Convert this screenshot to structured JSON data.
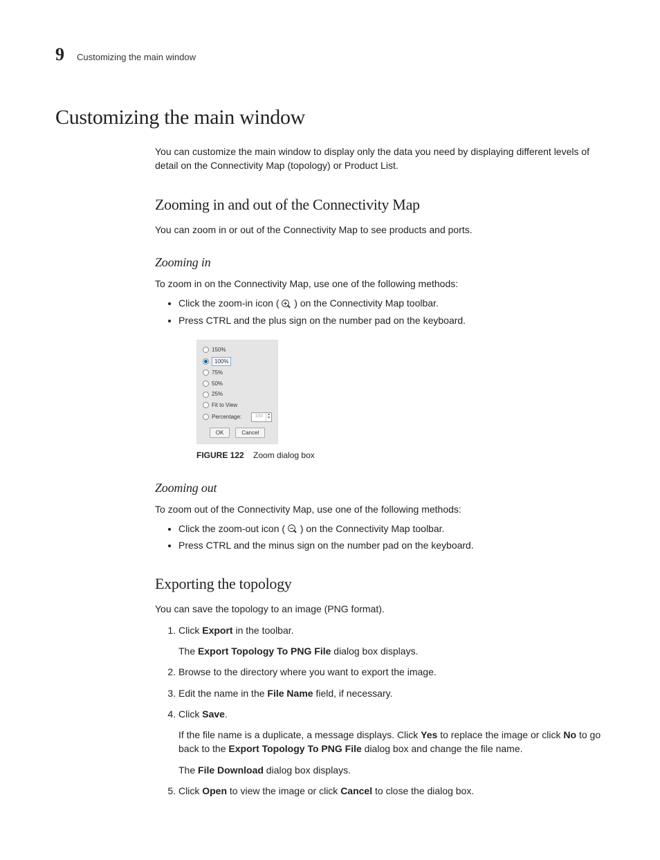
{
  "header": {
    "chapter_number": "9",
    "running_title": "Customizing the main window"
  },
  "h1": "Customizing the main window",
  "intro": "You can customize the main window to display only the data you need by displaying different levels of detail on the Connectivity Map (topology) or Product List.",
  "sec_zoom": {
    "title": "Zooming in and out of the Connectivity Map",
    "intro": "You can zoom in or out of the Connectivity Map to see products and ports.",
    "in": {
      "title": "Zooming in",
      "intro": "To zoom in on the Connectivity Map, use one of the following methods:",
      "b1_a": "Click the zoom-in icon (",
      "b1_b": ") on the Connectivity Map toolbar.",
      "b2": "Press CTRL and the plus sign on the number pad on the keyboard."
    },
    "out": {
      "title": "Zooming out",
      "intro": "To zoom out of the Connectivity Map, use one of the following methods:",
      "b1_a": "Click the zoom-out icon (",
      "b1_b": ") on the Connectivity Map toolbar.",
      "b2": "Press CTRL and the minus sign on the number pad on the keyboard."
    }
  },
  "figure": {
    "label": "FIGURE 122",
    "caption": "Zoom dialog box",
    "dialog": {
      "opt150": "150%",
      "opt100": "100%",
      "opt75": "75%",
      "opt50": "50%",
      "opt25": "25%",
      "fit": "Fit to View",
      "percentage_label": "Percentage:",
      "percentage_value": "100",
      "ok": "OK",
      "cancel": "Cancel"
    }
  },
  "sec_export": {
    "title": "Exporting the topology",
    "intro": "You can save the topology to an image (PNG format).",
    "s1_a": "Click ",
    "s1_b": "Export",
    "s1_c": " in the toolbar.",
    "s1_sub_a": "The ",
    "s1_sub_b": "Export Topology To PNG File",
    "s1_sub_c": " dialog box displays.",
    "s2": "Browse to the directory where you want to export the image.",
    "s3_a": "Edit the name in the ",
    "s3_b": "File Name",
    "s3_c": " field, if necessary.",
    "s4_a": "Click ",
    "s4_b": "Save",
    "s4_c": ".",
    "s4_sub1_a": "If the file name is a duplicate, a message displays. Click ",
    "s4_sub1_b": "Yes",
    "s4_sub1_c": " to replace the image or click ",
    "s4_sub1_d": "No",
    "s4_sub1_e": " to go back to the ",
    "s4_sub1_f": "Export Topology To PNG File",
    "s4_sub1_g": " dialog box and change the file name.",
    "s4_sub2_a": "The ",
    "s4_sub2_b": "File Download",
    "s4_sub2_c": " dialog box displays.",
    "s5_a": "Click ",
    "s5_b": "Open",
    "s5_c": " to view the image or click ",
    "s5_d": "Cancel",
    "s5_e": " to close the dialog box."
  }
}
